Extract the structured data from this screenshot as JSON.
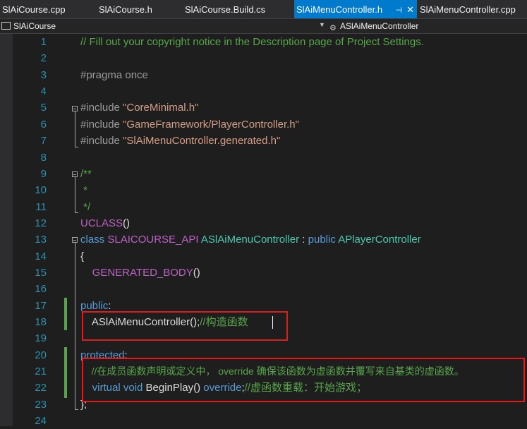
{
  "tabs": [
    {
      "label": "SlAiCourse.cpp",
      "active": false
    },
    {
      "label": "SlAiCourse.h",
      "active": false
    },
    {
      "label": "SlAiCourse.Build.cs",
      "active": false
    },
    {
      "label": "SlAiMenuController.h",
      "active": true
    },
    {
      "label": "SlAiMenuController.cpp",
      "active": false
    }
  ],
  "active_tab_icons": {
    "pin": "pin-icon",
    "close": "close-icon"
  },
  "navbar": {
    "project": "SlAiCourse",
    "scope": "ASlAiMenuController"
  },
  "lines": [
    {
      "n": "1",
      "t": [
        "// Fill out your copyright notice in the Description page of Project Settings."
      ]
    },
    {
      "n": "2",
      "t": []
    },
    {
      "n": "3",
      "t": [
        "#pragma once"
      ]
    },
    {
      "n": "4",
      "t": []
    },
    {
      "n": "5",
      "t": [
        "#include ",
        "\"CoreMinimal.h\""
      ]
    },
    {
      "n": "6",
      "t": [
        "#include ",
        "\"GameFramework/PlayerController.h\""
      ]
    },
    {
      "n": "7",
      "t": [
        "#include ",
        "\"SlAiMenuController.generated.h\""
      ]
    },
    {
      "n": "8",
      "t": []
    },
    {
      "n": "9",
      "t": [
        "/**"
      ]
    },
    {
      "n": "10",
      "t": [
        " *"
      ]
    },
    {
      "n": "11",
      "t": [
        " */"
      ]
    },
    {
      "n": "12",
      "t": [
        "UCLASS",
        "()"
      ]
    },
    {
      "n": "13",
      "t": [
        "class ",
        "SLAICOURSE_API ",
        "ASlAiMenuController",
        " : ",
        "public ",
        "APlayerController"
      ]
    },
    {
      "n": "14",
      "t": [
        "{"
      ]
    },
    {
      "n": "15",
      "t": [
        "    ",
        "GENERATED_BODY",
        "()"
      ]
    },
    {
      "n": "16",
      "t": []
    },
    {
      "n": "17",
      "t": [
        "public",
        ":"
      ]
    },
    {
      "n": "18",
      "t": [
        "    ",
        "ASlAiMenuController",
        "();",
        "//构造函数"
      ]
    },
    {
      "n": "19",
      "t": []
    },
    {
      "n": "20",
      "t": [
        "protected",
        ":"
      ]
    },
    {
      "n": "21",
      "t": [
        "    ",
        "//在成员函数声明或定义中， override 确保该函数为虚函数并覆写来自基类的虚函数。"
      ]
    },
    {
      "n": "22",
      "t": [
        "    ",
        "virtual ",
        "void ",
        "BeginPlay",
        "() ",
        "override",
        ";",
        "//虚函数重载：开始游戏；"
      ]
    },
    {
      "n": "23",
      "t": [
        "};"
      ]
    },
    {
      "n": "24",
      "t": []
    }
  ],
  "colors": {
    "comment": "#57a64a",
    "keyword": "#569cd6",
    "string": "#d69d85",
    "preprocessor": "#9b9b9b",
    "macro": "#bd63c5",
    "type": "#4ec9b0",
    "function": "#dcdcaa",
    "line_number": "#2b91af",
    "annotation_box": "#e21b1b",
    "active_tab": "#007acc"
  }
}
